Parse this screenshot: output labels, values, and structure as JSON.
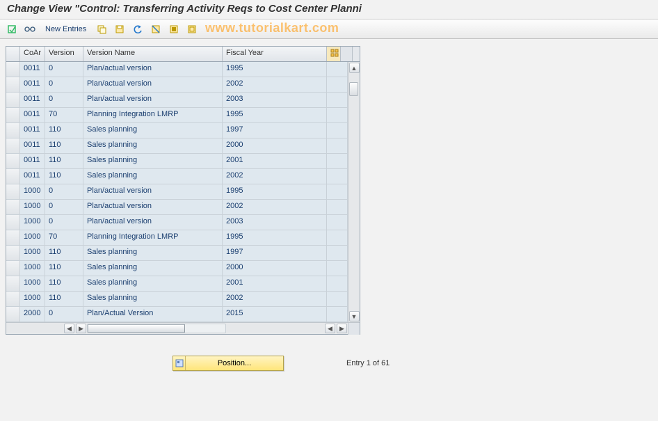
{
  "title": "Change View \"Control: Transferring Activity Reqs to Cost Center Planni",
  "watermark": "www.tutorialkart.com",
  "toolbar": {
    "new_entries_label": "New Entries",
    "icons": {
      "expand": "expand-icon",
      "glasses": "display-icon",
      "copy": "copy-icon",
      "save": "save-icon",
      "undo": "undo-icon",
      "delete": "delete-icon",
      "select_all": "select-all-icon",
      "deselect": "deselect-icon"
    }
  },
  "grid": {
    "columns": {
      "coar": "CoAr",
      "version": "Version",
      "version_name": "Version Name",
      "fiscal_year": "Fiscal Year"
    },
    "rows": [
      {
        "coar": "0011",
        "version": "0",
        "name": "Plan/actual version",
        "fy": "1995"
      },
      {
        "coar": "0011",
        "version": "0",
        "name": "Plan/actual version",
        "fy": "2002"
      },
      {
        "coar": "0011",
        "version": "0",
        "name": "Plan/actual version",
        "fy": "2003"
      },
      {
        "coar": "0011",
        "version": "70",
        "name": "Planning Integration LMRP",
        "fy": "1995"
      },
      {
        "coar": "0011",
        "version": "110",
        "name": "Sales planning",
        "fy": "1997"
      },
      {
        "coar": "0011",
        "version": "110",
        "name": "Sales planning",
        "fy": "2000"
      },
      {
        "coar": "0011",
        "version": "110",
        "name": "Sales planning",
        "fy": "2001"
      },
      {
        "coar": "0011",
        "version": "110",
        "name": "Sales planning",
        "fy": "2002"
      },
      {
        "coar": "1000",
        "version": "0",
        "name": "Plan/actual version",
        "fy": "1995"
      },
      {
        "coar": "1000",
        "version": "0",
        "name": "Plan/actual version",
        "fy": "2002"
      },
      {
        "coar": "1000",
        "version": "0",
        "name": "Plan/actual version",
        "fy": "2003"
      },
      {
        "coar": "1000",
        "version": "70",
        "name": "Planning Integration LMRP",
        "fy": "1995"
      },
      {
        "coar": "1000",
        "version": "110",
        "name": "Sales planning",
        "fy": "1997"
      },
      {
        "coar": "1000",
        "version": "110",
        "name": "Sales planning",
        "fy": "2000"
      },
      {
        "coar": "1000",
        "version": "110",
        "name": "Sales planning",
        "fy": "2001"
      },
      {
        "coar": "1000",
        "version": "110",
        "name": "Sales planning",
        "fy": "2002"
      },
      {
        "coar": "2000",
        "version": "0",
        "name": "Plan/Actual Version",
        "fy": "2015"
      }
    ]
  },
  "footer": {
    "position_label": "Position...",
    "entry_status": "Entry 1 of 61"
  }
}
